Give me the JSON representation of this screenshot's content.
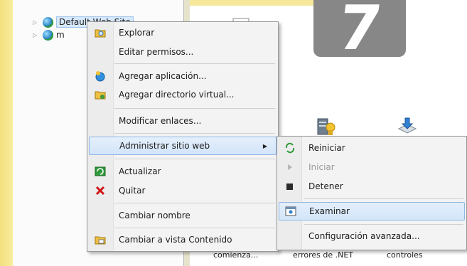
{
  "tree": {
    "items": [
      {
        "label": "Default Web Site",
        "selected": true
      },
      {
        "label": "m"
      }
    ]
  },
  "overlay": {
    "step_number": "7"
  },
  "content": {
    "bottom_labels": [
      "comienza...",
      "errores de .NET",
      "controles"
    ]
  },
  "context_menu": {
    "items": [
      {
        "label": "Explorar",
        "icon": "explore-folder-icon"
      },
      {
        "label": "Editar permisos..."
      },
      {
        "label": "Agregar aplicación...",
        "icon": "add-application-icon"
      },
      {
        "label": "Agregar directorio virtual...",
        "icon": "virtual-directory-icon"
      },
      {
        "label": "Modificar enlaces..."
      },
      {
        "label": "Administrar sitio web",
        "has_submenu": true
      },
      {
        "label": "Actualizar",
        "icon": "refresh-icon"
      },
      {
        "label": "Quitar",
        "icon": "remove-x-icon"
      },
      {
        "label": "Cambiar nombre"
      },
      {
        "label": "Cambiar a vista Contenido",
        "icon": "content-view-icon"
      }
    ]
  },
  "submenu": {
    "items": [
      {
        "label": "Reiniciar",
        "icon": "restart-icon"
      },
      {
        "label": "Iniciar",
        "icon": "start-play-icon",
        "disabled": true
      },
      {
        "label": "Detener",
        "icon": "stop-icon"
      },
      {
        "label": "Examinar",
        "icon": "browse-icon"
      },
      {
        "label": "Configuración avanzada..."
      }
    ]
  },
  "colors": {
    "menu_bg": "#f3f3f3",
    "hover": "#d3e5fa",
    "hover_border": "#8fb6e3",
    "overlay": "#878787",
    "remove_red": "#d41515"
  }
}
